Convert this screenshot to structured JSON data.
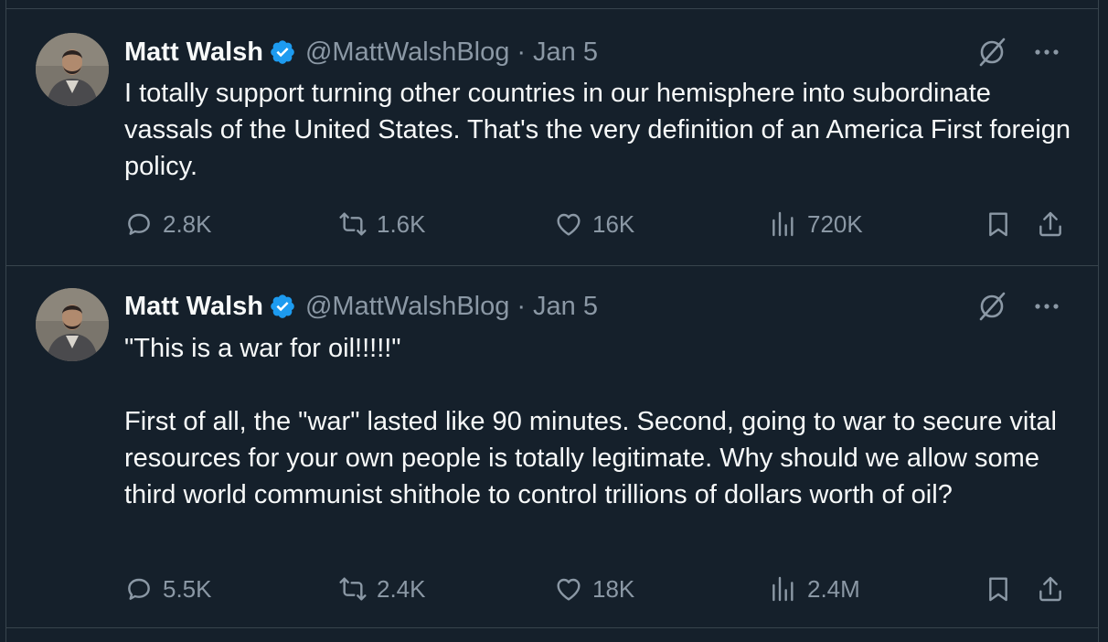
{
  "tweets": [
    {
      "author": {
        "name": "Matt Walsh",
        "handle": "@MattWalshBlog",
        "separator": "·",
        "date": "Jan 5",
        "verified_color": "#1d9bf0"
      },
      "text": [
        "I totally support turning other countries in our hemisphere into subordinate vassals of the United States. That's the very definition of an America First foreign policy."
      ],
      "stats": {
        "replies": "2.8K",
        "reposts": "1.6K",
        "likes": "16K",
        "views": "720K"
      }
    },
    {
      "author": {
        "name": "Matt Walsh",
        "handle": "@MattWalshBlog",
        "separator": "·",
        "date": "Jan 5",
        "verified_color": "#1d9bf0"
      },
      "text": [
        "\"This is a war for oil!!!!!\"",
        "First of all, the \"war\" lasted like 90 minutes. Second, going to war to secure vital resources for your own people is totally legitimate. Why should we allow some third world communist shithole to control trillions of dollars worth of oil?"
      ],
      "stats": {
        "replies": "5.5K",
        "reposts": "2.4K",
        "likes": "18K",
        "views": "2.4M"
      }
    }
  ],
  "icons": {
    "reply": "speech-bubble-icon",
    "repost": "repost-arrows-icon",
    "like": "heart-icon",
    "views": "bar-chart-icon",
    "bookmark": "bookmark-icon",
    "share": "share-upload-icon",
    "grok": "grok-slash-circle-icon",
    "more": "ellipsis-icon",
    "verified": "verified-badge-icon"
  },
  "colors": {
    "background": "#15202b",
    "text": "#f7f9f9",
    "secondary": "#8b98a5",
    "border": "#38444d",
    "verified": "#1d9bf0"
  }
}
